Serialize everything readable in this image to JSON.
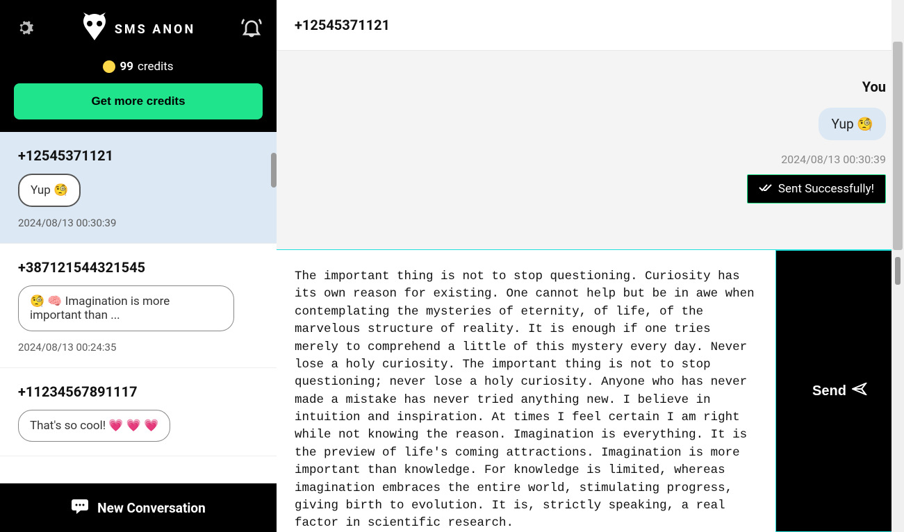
{
  "brand": "SMS ANON",
  "credits": {
    "amount": "99",
    "label": "credits"
  },
  "get_more_label": "Get more credits",
  "conversations": [
    {
      "number": "+12545371121",
      "preview": "Yup 🧐",
      "time": "2024/08/13 00:30:39",
      "active": true
    },
    {
      "number": "+387121544321545",
      "preview": "🧐 🧠 Imagination is more important than ...",
      "time": "2024/08/13 00:24:35",
      "active": false
    },
    {
      "number": "+11234567891117",
      "preview": "That's so cool! 💗 💗 💗",
      "time": "",
      "active": false
    }
  ],
  "new_conversation_label": "New Conversation",
  "chat_header": "+12545371121",
  "message": {
    "sender": "You",
    "text": "Yup 🧐",
    "time": "2024/08/13 00:30:39",
    "status": "Sent Successfully!"
  },
  "compose_value": "The important thing is not to stop questioning. Curiosity has its own reason for existing. One cannot help but be in awe when contemplating the mysteries of eternity, of life, of the marvelous structure of reality. It is enough if one tries merely to comprehend a little of this mystery every day. Never lose a holy curiosity. The important thing is not to stop questioning; never lose a holy curiosity. Anyone who has never made a mistake has never tried anything new. I believe in intuition and inspiration. At times I feel certain I am right while not knowing the reason. Imagination is everything. It is the preview of life's coming attractions. Imagination is more important than knowledge. For knowledge is limited, whereas imagination embraces the entire world, stimulating progress, giving birth to evolution. It is, strictly speaking, a real factor in scientific research.",
  "send_label": "Send"
}
